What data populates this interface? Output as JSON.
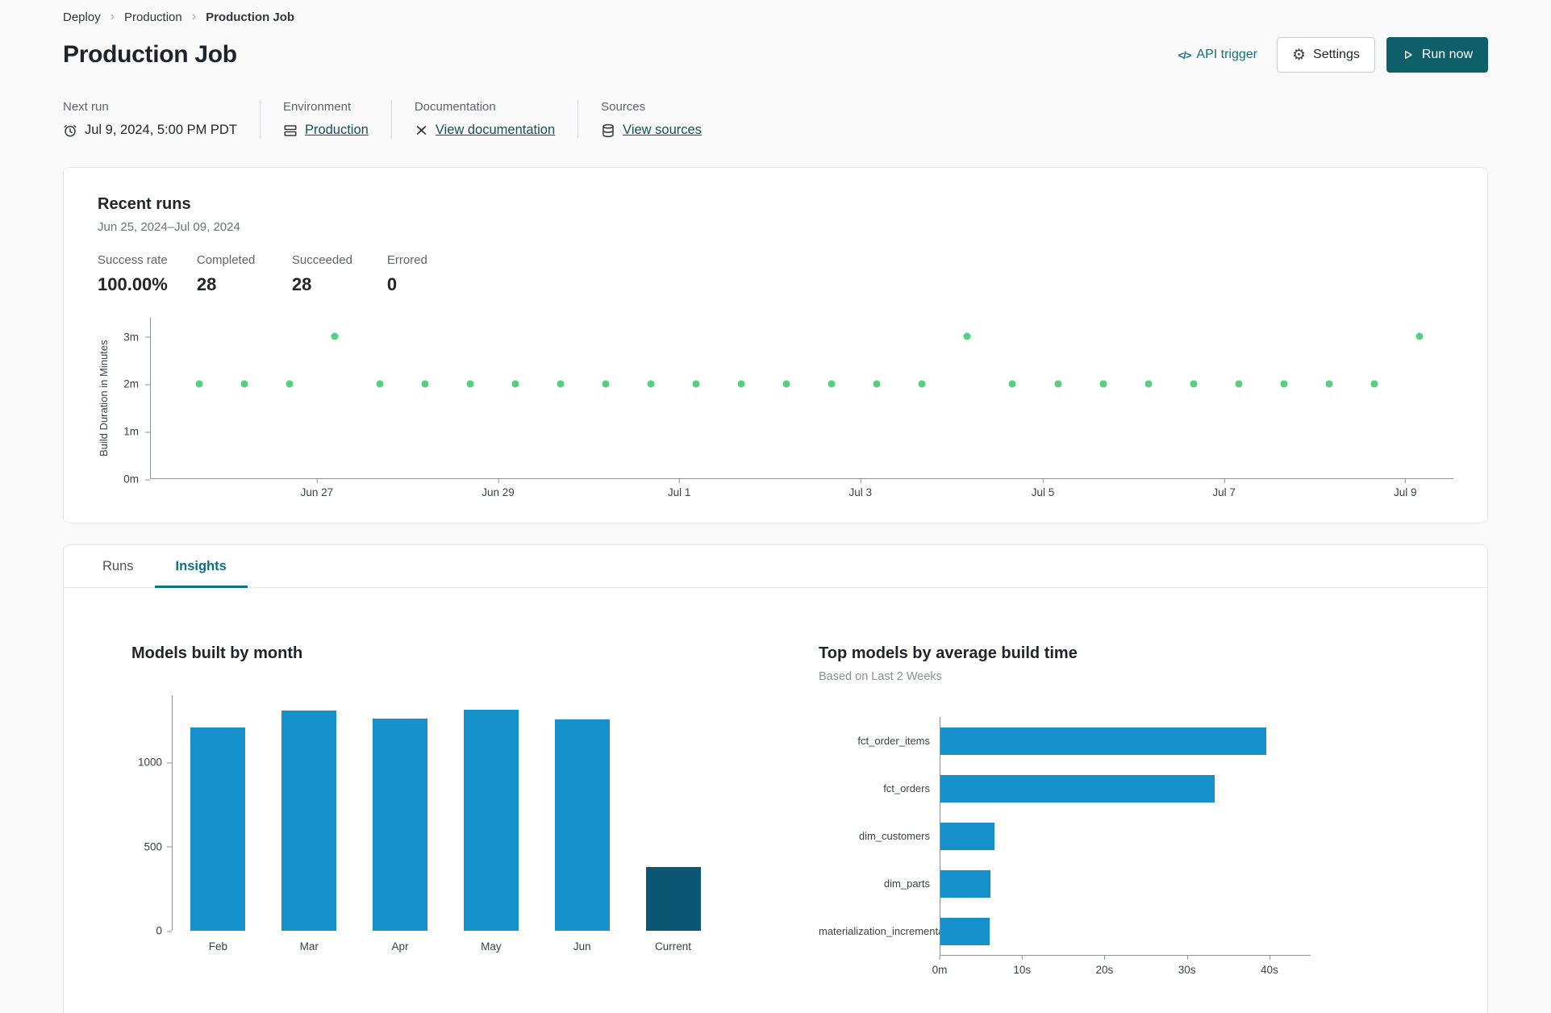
{
  "breadcrumb": {
    "separator_glyph": "›",
    "items": [
      {
        "label": "Deploy"
      },
      {
        "label": "Production"
      },
      {
        "label": "Production Job"
      }
    ]
  },
  "header": {
    "title": "Production Job",
    "api_trigger": {
      "label": "API trigger",
      "icon_glyph": "</>"
    },
    "settings_button": {
      "label": "Settings",
      "icon_glyph": "⚙"
    },
    "run_now_button": {
      "label": "Run now"
    }
  },
  "info_panel": {
    "next_run": {
      "label": "Next run",
      "value": "Jul 9, 2024, 5:00 PM PDT"
    },
    "environment": {
      "label": "Environment",
      "value": "Production"
    },
    "documentation": {
      "label": "Documentation",
      "value": "View documentation"
    },
    "sources": {
      "label": "Sources",
      "value": "View sources"
    }
  },
  "recent_runs": {
    "title": "Recent runs",
    "date_range": "Jun 25, 2024–Jul 09, 2024",
    "stats": [
      {
        "label": "Success rate",
        "value": "100.00%"
      },
      {
        "label": "Completed",
        "value": "28"
      },
      {
        "label": "Succeeded",
        "value": "28"
      },
      {
        "label": "Errored",
        "value": "0"
      }
    ]
  },
  "tabs": [
    {
      "label": "Runs",
      "active": false
    },
    {
      "label": "Insights",
      "active": true
    }
  ],
  "colors": {
    "accent": "#0e7180",
    "primary_button": "#0e5f6a",
    "link": "#14505a",
    "run_dot": "#56cf82",
    "bar_blue": "#1590ca",
    "bar_dark": "#0b5673",
    "axis": "#8b9299",
    "text": "#23282d",
    "muted": "#5c646c",
    "border": "#e4e7ea",
    "page_bg": "#fafafa"
  },
  "chart_data": [
    {
      "id": "build_duration",
      "type": "scatter",
      "title": "",
      "ylabel": "Build Duration in Minutes",
      "ylim": [
        0,
        3.4
      ],
      "point_color": "#56cf82",
      "points_start_frac": 0.037,
      "points_step_frac": 0.0347,
      "points_minutes": [
        2,
        2,
        2,
        3,
        2,
        2,
        2,
        2,
        2,
        2,
        2,
        2,
        2,
        2,
        2,
        2,
        2,
        3,
        2,
        2,
        2,
        2,
        2,
        2,
        2,
        2,
        2,
        3
      ],
      "y_ticks": [
        {
          "label": "0m",
          "value": 0
        },
        {
          "label": "1m",
          "value": 1
        },
        {
          "label": "2m",
          "value": 2
        },
        {
          "label": "3m",
          "value": 3
        }
      ],
      "x_ticks": [
        {
          "label": "Jun 27",
          "frac": 0.128
        },
        {
          "label": "Jun 29",
          "frac": 0.267
        },
        {
          "label": "Jul 1",
          "frac": 0.406
        },
        {
          "label": "Jul 3",
          "frac": 0.545
        },
        {
          "label": "Jul 5",
          "frac": 0.685
        },
        {
          "label": "Jul 7",
          "frac": 0.824
        },
        {
          "label": "Jul 9",
          "frac": 0.963
        }
      ]
    },
    {
      "id": "models_built_by_month",
      "type": "bar",
      "title": "Models built by month",
      "categories": [
        "Feb",
        "Mar",
        "Apr",
        "May",
        "Jun",
        "Current"
      ],
      "values": [
        1210,
        1310,
        1260,
        1315,
        1255,
        380
      ],
      "ylim": [
        0,
        1400
      ],
      "y_ticks": [
        {
          "label": "0",
          "value": 0
        },
        {
          "label": "500",
          "value": 500
        },
        {
          "label": "1000",
          "value": 1000
        }
      ],
      "bar_color": "#1590ca",
      "highlight_category": "Current",
      "highlight_color": "#0b5673"
    },
    {
      "id": "top_models_by_build_time",
      "type": "bar_horizontal",
      "title": "Top models by average build time",
      "subtitle": "Based on Last 2 Weeks",
      "categories": [
        "fct_order_items",
        "fct_orders",
        "dim_customers",
        "dim_parts",
        "materialization_incremental"
      ],
      "values_seconds": [
        39.6,
        33.3,
        6.6,
        6.1,
        6.0
      ],
      "xlim": [
        0,
        45
      ],
      "x_ticks": [
        {
          "label": "0m",
          "value": 0
        },
        {
          "label": "10s",
          "value": 10
        },
        {
          "label": "20s",
          "value": 20
        },
        {
          "label": "30s",
          "value": 30
        },
        {
          "label": "40s",
          "value": 40
        }
      ],
      "bar_color": "#1590ca"
    }
  ]
}
